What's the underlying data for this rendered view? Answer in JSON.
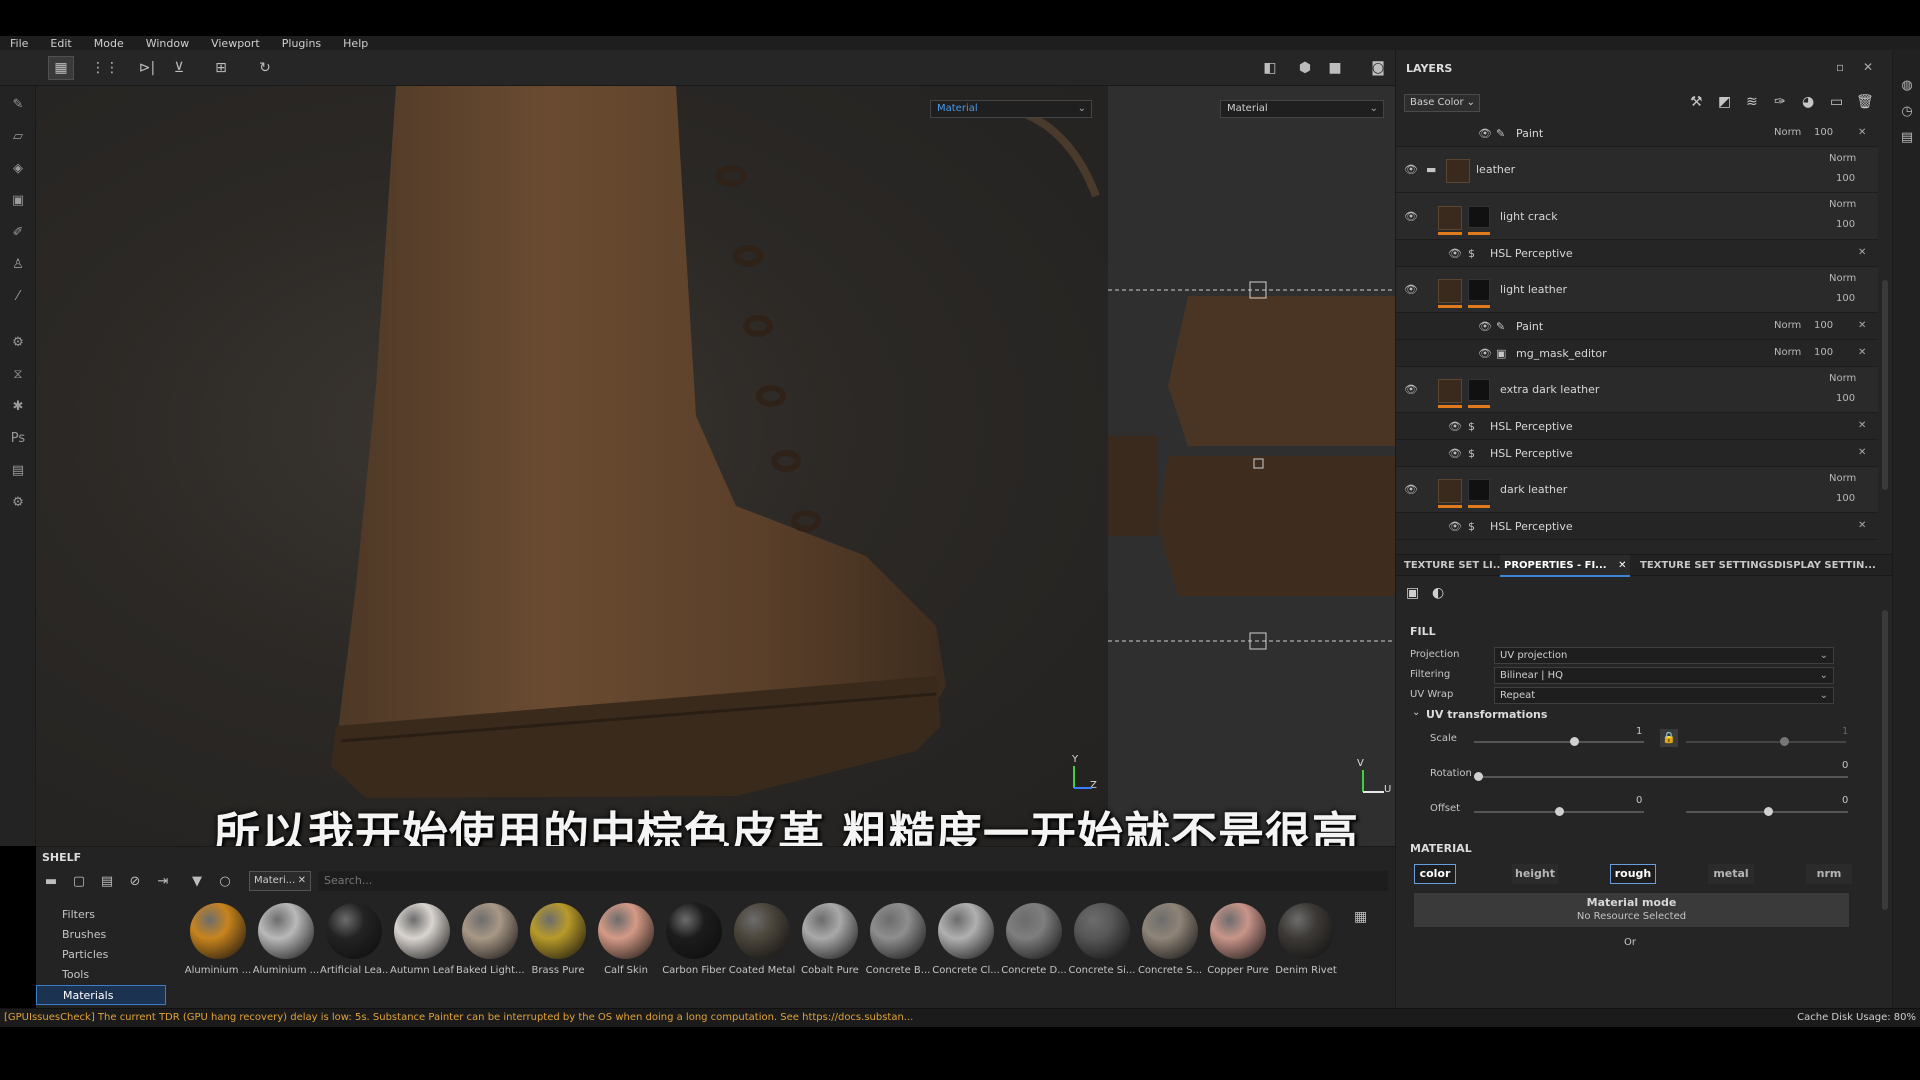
{
  "menu": [
    "File",
    "Edit",
    "Mode",
    "Window",
    "Viewport",
    "Plugins",
    "Help"
  ],
  "viewport": {
    "left_dropdown": "Material",
    "right_dropdown": "Material",
    "axis_3d": {
      "y": "Y",
      "z": "Z"
    },
    "axis_uv": {
      "v": "V",
      "u": "U"
    }
  },
  "subtitle": "所以我开始使用的中棕色皮革  粗糙度一开始就不是很高",
  "shelf": {
    "title": "SHELF",
    "tag": "Materi...",
    "search_placeholder": "Search...",
    "categories": [
      "Filters",
      "Brushes",
      "Particles",
      "Tools",
      "Materials"
    ],
    "materials": [
      {
        "name": "Aluminium ...",
        "color": "#c8841e"
      },
      {
        "name": "Aluminium ...",
        "color": "#b9b9b9"
      },
      {
        "name": "Artificial Lea...",
        "color": "#232323"
      },
      {
        "name": "Autumn Leaf",
        "color": "#d9d4cf"
      },
      {
        "name": "Baked Light...",
        "color": "#a89886"
      },
      {
        "name": "Brass Pure",
        "color": "#b89a2a"
      },
      {
        "name": "Calf Skin",
        "color": "#d49a86"
      },
      {
        "name": "Carbon Fiber",
        "color": "#1c1c1c"
      },
      {
        "name": "Coated Metal",
        "color": "#4c463c"
      },
      {
        "name": "Cobalt Pure",
        "color": "#a9a9a9"
      },
      {
        "name": "Concrete B...",
        "color": "#8e8e8e"
      },
      {
        "name": "Concrete Cl...",
        "color": "#b0b0b0"
      },
      {
        "name": "Concrete D...",
        "color": "#7e7e7e"
      },
      {
        "name": "Concrete Si...",
        "color": "#575757"
      },
      {
        "name": "Concrete S...",
        "color": "#8f8478"
      },
      {
        "name": "Copper Pure",
        "color": "#c9958a"
      },
      {
        "name": "Denim Rivet",
        "color": "#3d3a36"
      }
    ]
  },
  "status": {
    "warning": "[GPUIssuesCheck] The current TDR (GPU hang recovery) delay is low: 5s. Substance Painter can be interrupted by the OS when doing a long computation. See https://docs.substan...",
    "cache": "Cache Disk Usage:   80%"
  },
  "layers": {
    "title": "LAYERS",
    "channel": "Base Color",
    "rows": [
      {
        "kind": "sub",
        "name": "Paint",
        "blend": "Norm",
        "opacity": "100"
      },
      {
        "kind": "folder",
        "name": "leather",
        "blend": "Norm",
        "opacity": "100"
      },
      {
        "kind": "fill",
        "name": "light crack",
        "blend": "Norm",
        "opacity": "100"
      },
      {
        "kind": "effect",
        "name": "HSL Perceptive"
      },
      {
        "kind": "fill",
        "name": "light leather",
        "blend": "Norm",
        "opacity": "100"
      },
      {
        "kind": "sub",
        "name": "Paint",
        "blend": "Norm",
        "opacity": "100"
      },
      {
        "kind": "sub",
        "name": "mg_mask_editor",
        "blend": "Norm",
        "opacity": "100"
      },
      {
        "kind": "fill",
        "name": "extra dark leather",
        "blend": "Norm",
        "opacity": "100"
      },
      {
        "kind": "effect",
        "name": "HSL Perceptive"
      },
      {
        "kind": "effect",
        "name": "HSL Perceptive"
      },
      {
        "kind": "fill",
        "name": "dark leather",
        "blend": "Norm",
        "opacity": "100"
      },
      {
        "kind": "effect",
        "name": "HSL Perceptive"
      }
    ]
  },
  "tabs": [
    "TEXTURE SET LI...",
    "PROPERTIES - FI...",
    "TEXTURE SET SETTINGS",
    "DISPLAY SETTIN..."
  ],
  "properties": {
    "fill_title": "FILL",
    "projection_label": "Projection",
    "projection": "UV projection",
    "filtering_label": "Filtering",
    "filtering": "Bilinear | HQ",
    "uvwrap_label": "UV Wrap",
    "uvwrap": "Repeat",
    "uvt_title": "UV transformations",
    "scale_label": "Scale",
    "scale_value": "1",
    "scale_value2": "1",
    "rotation_label": "Rotation",
    "rotation_value": "0",
    "offset_label": "Offset",
    "offset_value": "0",
    "offset_value2": "0",
    "material_title": "MATERIAL",
    "channels": [
      {
        "label": "color",
        "on": true
      },
      {
        "label": "height",
        "on": false
      },
      {
        "label": "rough",
        "on": true
      },
      {
        "label": "metal",
        "on": false
      },
      {
        "label": "nrm",
        "on": false
      }
    ],
    "material_mode_title": "Material mode",
    "material_mode_sub": "No Resource Selected",
    "or_text": "Or"
  },
  "colors": {
    "accent": "#3d85d6",
    "layer_marker": "#e07a1a",
    "warning": "#e0a23a"
  }
}
